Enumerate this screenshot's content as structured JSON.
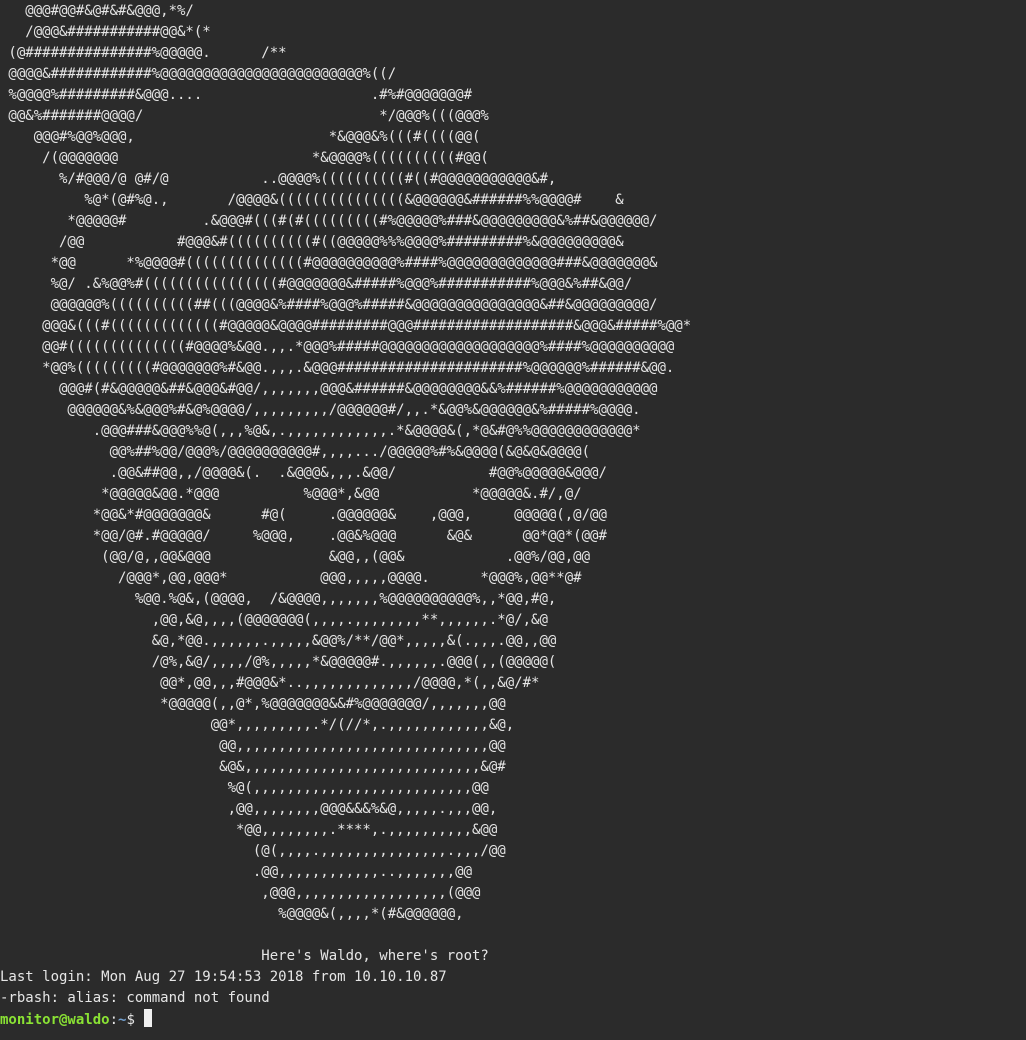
{
  "terminal": {
    "art_lines": [
      "   @@@#@@#&@#&#&@@@,*%/",
      "   /@@@&###########@@&*(*",
      " (@###############%@@@@@.      /**",
      " @@@@&############%@@@@@@@@@@@@@@@@@@@@@@@@%((/",
      " %@@@@%#########&@@@....                    .#%#@@@@@@@#",
      " @@&%#######@@@@/                            */@@@%(((@@@%",
      "    @@@#%@@%@@@,                       *&@@@&%(((#((((@@(",
      "     /(@@@@@@@                       *&@@@@%((((((((((#@@(",
      "       %/#@@@/@ @#/@           ..@@@@%((((((((((#((#@@@@@@@@@@@&#,",
      "          %@*(@#%@.,       /@@@@&(((((((((((((((&@@@@@@&######%%@@@@#    &",
      "        *@@@@@#         .&@@@#(((#(#(((((((((#%@@@@@%###&@@@@@@@@@&%##&@@@@@@/",
      "       /@@           #@@@&#((((((((((#((@@@@@%%%@@@@%#########%&@@@@@@@@@&",
      "      *@@      *%@@@@#((((((((((((((#@@@@@@@@@@%####%@@@@@@@@@@@@@###&@@@@@@@&",
      "      %@/ .&%@@%#((((((((((((((((#@@@@@@@&#####%@@@%###########%@@@&%##&@@/",
      "      @@@@@@%((((((((((##(((@@@@&%####%@@@%#####&@@@@@@@@@@@@@@@&##&@@@@@@@@@/",
      "     @@@&(((#(((((((((((((#@@@@@&@@@@#########@@@###################&@@@&#####%@@*",
      "     @@#((((((((((((((#@@@@%&@@.,,.*@@@%#####@@@@@@@@@@@@@@@@@@@%####%@@@@@@@@@@",
      "     *@@%(((((((((#@@@@@@@%#&@@.,,,.&@@@######################%@@@@@@%######&@@.",
      "       @@@#(#&@@@@@&##&@@@&#@@/,,,,,,,@@@&######&@@@@@@@@&&%######%@@@@@@@@@@@",
      "        @@@@@@&%&@@@%#&@%@@@@/,,,,,,,,,/@@@@@@#/,,.*&@@%&@@@@@@&%#####%@@@@.",
      "           .@@@###&@@@%%@(,,,%@&,.,,,,,,,,,,,,.*&@@@@&(,*@&#@%%@@@@@@@@@@@@*",
      "             @@%##%@@/@@@%/@@@@@@@@@@#,,,,.../@@@@@%#%&@@@@(&@&@&@@@@(",
      "             .@@&##@@,,/@@@@&(.  .&@@@&,,,.&@@/           #@@%@@@@@&@@@/",
      "            *@@@@@&@@.*@@@          %@@@*,&@@           *@@@@@&.#/,@/",
      "           *@@&*#@@@@@@@&      #@(     .@@@@@@&    ,@@@,     @@@@@(,@/@@",
      "           *@@/@#.#@@@@@/     %@@@,    .@@&%@@@      &@&      @@*@@*(@@#",
      "            (@@/@,,@@&@@@              &@@,,(@@&            .@@%/@@,@@",
      "              /@@@*,@@,@@@*           @@@,,,,,@@@@.      *@@@%,@@**@#",
      "                %@@.%@&,(@@@@,  /&@@@@,,,,,,,%@@@@@@@@@@%,,*@@,#@,",
      "                  ,@@,&@,,,,(@@@@@@@(,,,,.,,,,,,,,**,,,,,,.*@/,&@",
      "                  &@,*@@.,,,,,,.,,,,,&@@%/**/@@*,,,,,&(.,,,.@@,,@@",
      "                  /@%,&@/,,,,/@%,,,,,*&@@@@@#.,,,,,,.@@@(,,(@@@@@(",
      "                   @@*,@@,,,#@@@&*..,,,,,,,,,,,,,/@@@@,*(,,&@/#*",
      "                   *@@@@@(,,@*,%@@@@@@@&&#%@@@@@@@/,,,,,,,@@",
      "                         @@*,,,,,,,,,.*/(//*,.,,,,,,,,,,,,&@,",
      "                          @@,,,,,,,,,,,,,,,,,,,,,,,,,,,,,,@@",
      "                          &@&,,,,,,,,,,,,,,,,,,,,,,,,,,,,&@#",
      "                           %@(,,,,,,,,,,,,,,,,,,,,,,,,,,@@",
      "                           ,@@,,,,,,,,@@@&&&%&@,,,,,.,,,@@,",
      "                            *@@,,,,,,,,.****,.,,,,,,,,,,&@@",
      "                              (@(,,,,.,,,,,,,,,,,,,,,.,,,/@@",
      "                              .@@,,,,,,,,,,,,..,,,,,,,@@",
      "                               ,@@@,,,,,,,,,,,,,,,,,,(@@@",
      "                                 %@@@@&(,,,,*(#&@@@@@@,"
    ],
    "blank_line": "",
    "banner": "                               Here's Waldo, where's root?",
    "last_login": "Last login: Mon Aug 27 19:54:53 2018 from 10.10.10.87",
    "error_line": "-rbash: alias: command not found",
    "prompt": {
      "user_host": "monitor@waldo",
      "separator": ":",
      "path": "~",
      "symbol": "$ "
    },
    "colors": {
      "background": "#2b2b2b",
      "foreground": "#e6e6e6",
      "user_host": "#8ae234",
      "path": "#729fcf"
    }
  }
}
